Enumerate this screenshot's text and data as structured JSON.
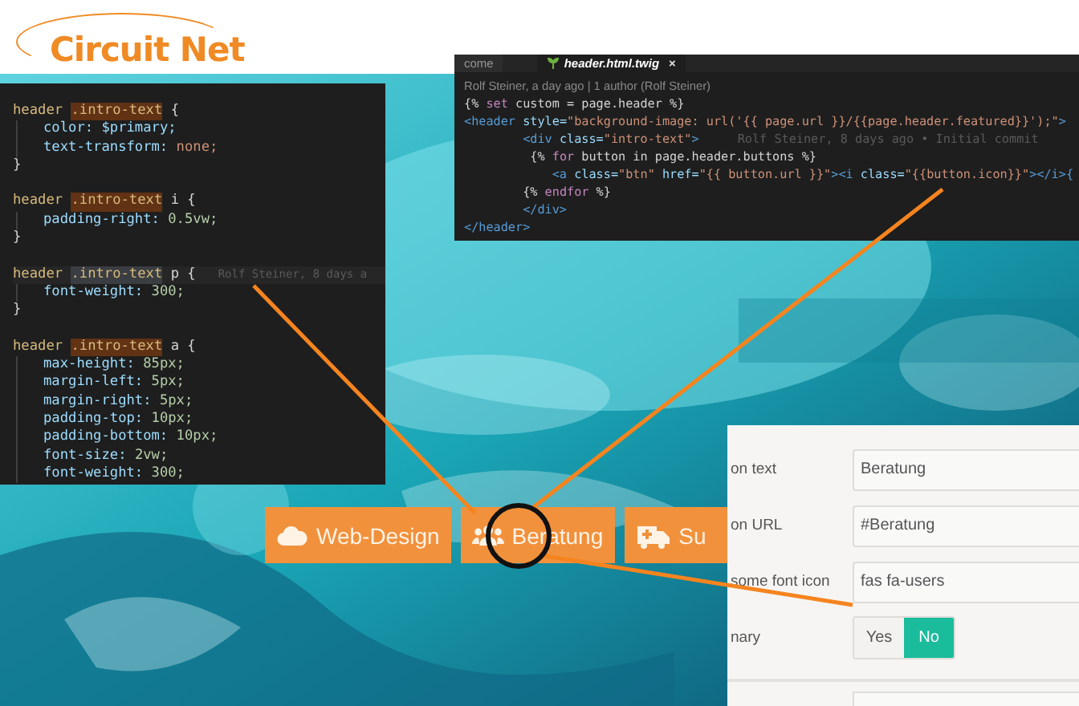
{
  "logo": {
    "text": "Circuit Net"
  },
  "css_editor": {
    "rules": [
      {
        "selector": [
          {
            "text": "header ",
            "kind": "selector"
          },
          {
            "text": ".intro-text",
            "kind": "match"
          },
          {
            "text": " {",
            "kind": "plain"
          }
        ],
        "declarations": [
          {
            "property": "color:",
            "value": "$primary;",
            "kind": "variable"
          },
          {
            "property": "text-transform:",
            "value": "none;",
            "kind": "keyword"
          }
        ],
        "close": "}"
      },
      {
        "selector": [
          {
            "text": "header ",
            "kind": "selector"
          },
          {
            "text": ".intro-text",
            "kind": "match"
          },
          {
            "text": " i {",
            "kind": "plain"
          }
        ],
        "declarations": [
          {
            "property": "padding-right:",
            "value": "0.5vw;",
            "kind": "number"
          }
        ],
        "close": "}"
      },
      {
        "selector": [
          {
            "text": "header ",
            "kind": "selector"
          },
          {
            "text": ".intro-text",
            "kind": "current"
          },
          {
            "text": " p {",
            "kind": "plain"
          }
        ],
        "blame": "Rolf Steiner, 8 days a",
        "declarations": [
          {
            "property": "font-weight:",
            "value": "300;",
            "kind": "number"
          }
        ],
        "close": "}"
      },
      {
        "selector": [
          {
            "text": "header ",
            "kind": "selector"
          },
          {
            "text": ".intro-text",
            "kind": "match"
          },
          {
            "text": " a {",
            "kind": "plain"
          }
        ],
        "declarations": [
          {
            "property": "max-height:",
            "value": "85px;",
            "kind": "number"
          },
          {
            "property": "margin-left:",
            "value": "5px;",
            "kind": "number"
          },
          {
            "property": "margin-right:",
            "value": "5px;",
            "kind": "number"
          },
          {
            "property": "padding-top:",
            "value": "10px;",
            "kind": "number"
          },
          {
            "property": "padding-bottom:",
            "value": "10px;",
            "kind": "number"
          },
          {
            "property": "font-size:",
            "value": "2vw;",
            "kind": "number"
          },
          {
            "property": "font-weight:",
            "value": "300;",
            "kind": "number"
          }
        ]
      }
    ]
  },
  "twig_editor": {
    "tabs": [
      {
        "label": "come",
        "selected": false
      },
      {
        "label": "header.html.twig",
        "selected": true,
        "close": "×"
      }
    ],
    "blame_header": "Rolf Steiner, a day ago | 1 author (Rolf Steiner)",
    "lines": [
      {
        "segments": [
          {
            "text": "{% ",
            "kind": "plain"
          },
          {
            "text": "set",
            "kind": "keyword"
          },
          {
            "text": " custom = page.header %}",
            "kind": "plain"
          }
        ]
      },
      {
        "segments": [
          {
            "text": "<header",
            "kind": "tag"
          },
          {
            "text": " style=",
            "kind": "attr"
          },
          {
            "text": "\"background-image: url('{{ page.url }}/{{page.header.featured}}');\"",
            "kind": "string"
          },
          {
            "text": ">",
            "kind": "tag"
          }
        ]
      },
      {
        "segments": [
          {
            "text": "        <div",
            "kind": "tag"
          },
          {
            "text": " class=",
            "kind": "attr"
          },
          {
            "text": "\"intro-text\"",
            "kind": "string"
          },
          {
            "text": ">",
            "kind": "tag"
          }
        ],
        "blame": "Rolf Steiner, 8 days ago • Initial commit"
      },
      {
        "segments": [
          {
            "text": "         {% ",
            "kind": "plain"
          },
          {
            "text": "for",
            "kind": "keyword"
          },
          {
            "text": " button in page.header.buttons %}",
            "kind": "plain"
          }
        ]
      },
      {
        "segments": [
          {
            "text": "            <a",
            "kind": "tag"
          },
          {
            "text": " class=",
            "kind": "attr"
          },
          {
            "text": "\"btn\"",
            "kind": "string"
          },
          {
            "text": " href=",
            "kind": "attr"
          },
          {
            "text": "\"{{ button.url }}\"",
            "kind": "string"
          },
          {
            "text": "><i",
            "kind": "tag"
          },
          {
            "text": " class=",
            "kind": "attr"
          },
          {
            "text": "\"{{button.icon}}\"",
            "kind": "string"
          },
          {
            "text": "></i>{",
            "kind": "tag"
          }
        ]
      },
      {
        "segments": [
          {
            "text": "        {% ",
            "kind": "plain"
          },
          {
            "text": "endfor",
            "kind": "keyword"
          },
          {
            "text": " %}",
            "kind": "plain"
          }
        ]
      },
      {
        "segments": [
          {
            "text": "        </div>",
            "kind": "tag"
          }
        ]
      },
      {
        "segments": [
          {
            "text": "</header>",
            "kind": "tag"
          }
        ]
      }
    ]
  },
  "hero": {
    "buttons": [
      {
        "label": "Web-Design",
        "kind": "cloud",
        "circled": false
      },
      {
        "label": "Beratung",
        "kind": "users",
        "circled": true
      },
      {
        "label": "Su",
        "kind": "ambulance",
        "circled": false
      }
    ]
  },
  "form": {
    "fields": [
      {
        "kind": "text",
        "label": "on text",
        "value": "Beratung"
      },
      {
        "kind": "text",
        "label": "on URL",
        "value": "#Beratung"
      },
      {
        "kind": "text",
        "label": "some font icon",
        "value": "fas fa-users"
      },
      {
        "kind": "toggle",
        "label": "nary",
        "options": [
          {
            "label": "Yes",
            "selected": false
          },
          {
            "label": "No",
            "selected": true
          }
        ]
      }
    ]
  }
}
